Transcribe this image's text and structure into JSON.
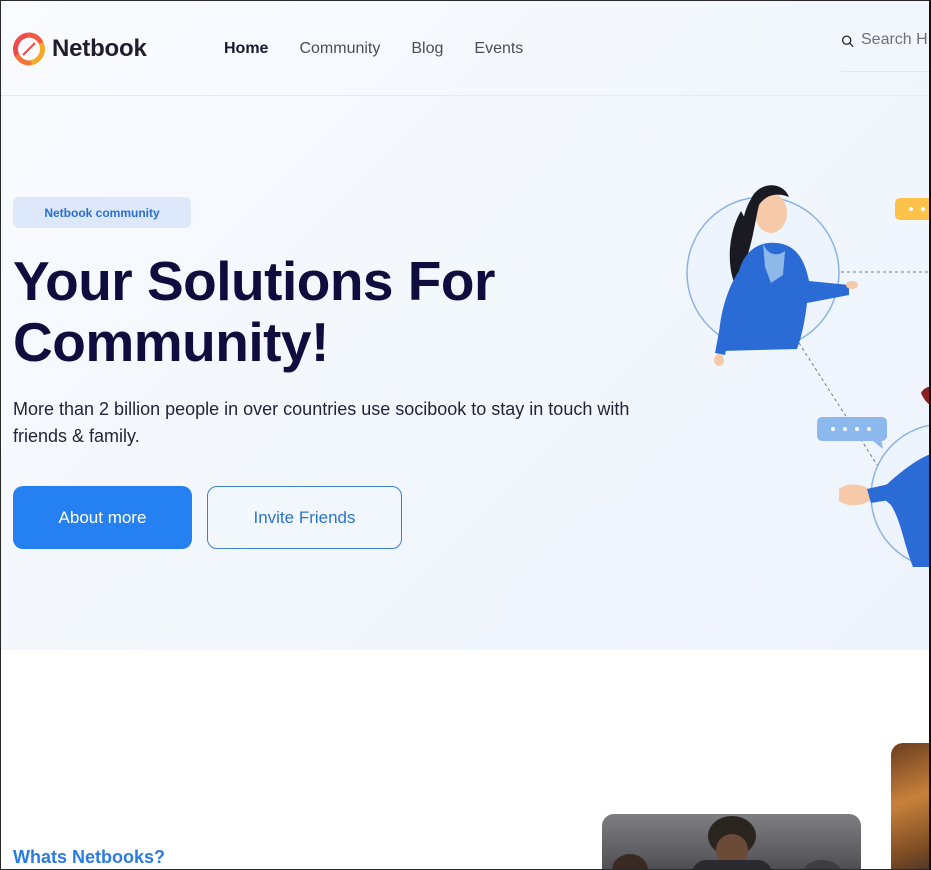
{
  "header": {
    "logo_text": "Netbook",
    "nav": [
      {
        "label": "Home",
        "active": true
      },
      {
        "label": "Community",
        "active": false
      },
      {
        "label": "Blog",
        "active": false
      },
      {
        "label": "Events",
        "active": false
      }
    ],
    "search_placeholder": "Search H"
  },
  "hero": {
    "badge": "Netbook community",
    "title_line1": "Your Solutions For",
    "title_line2": "Community!",
    "subtitle": "More than 2 billion people in over countries use socibook to stay in touch with friends & family.",
    "primary_button": "About more",
    "secondary_button": "Invite Friends"
  },
  "about": {
    "label": "Whats Netbooks?"
  },
  "colors": {
    "accent": "#2580f1",
    "title": "#0f0d3d",
    "badge_bg": "#dde9fa",
    "logo_red": "#ef4b4b",
    "logo_orange": "#f7a928"
  }
}
